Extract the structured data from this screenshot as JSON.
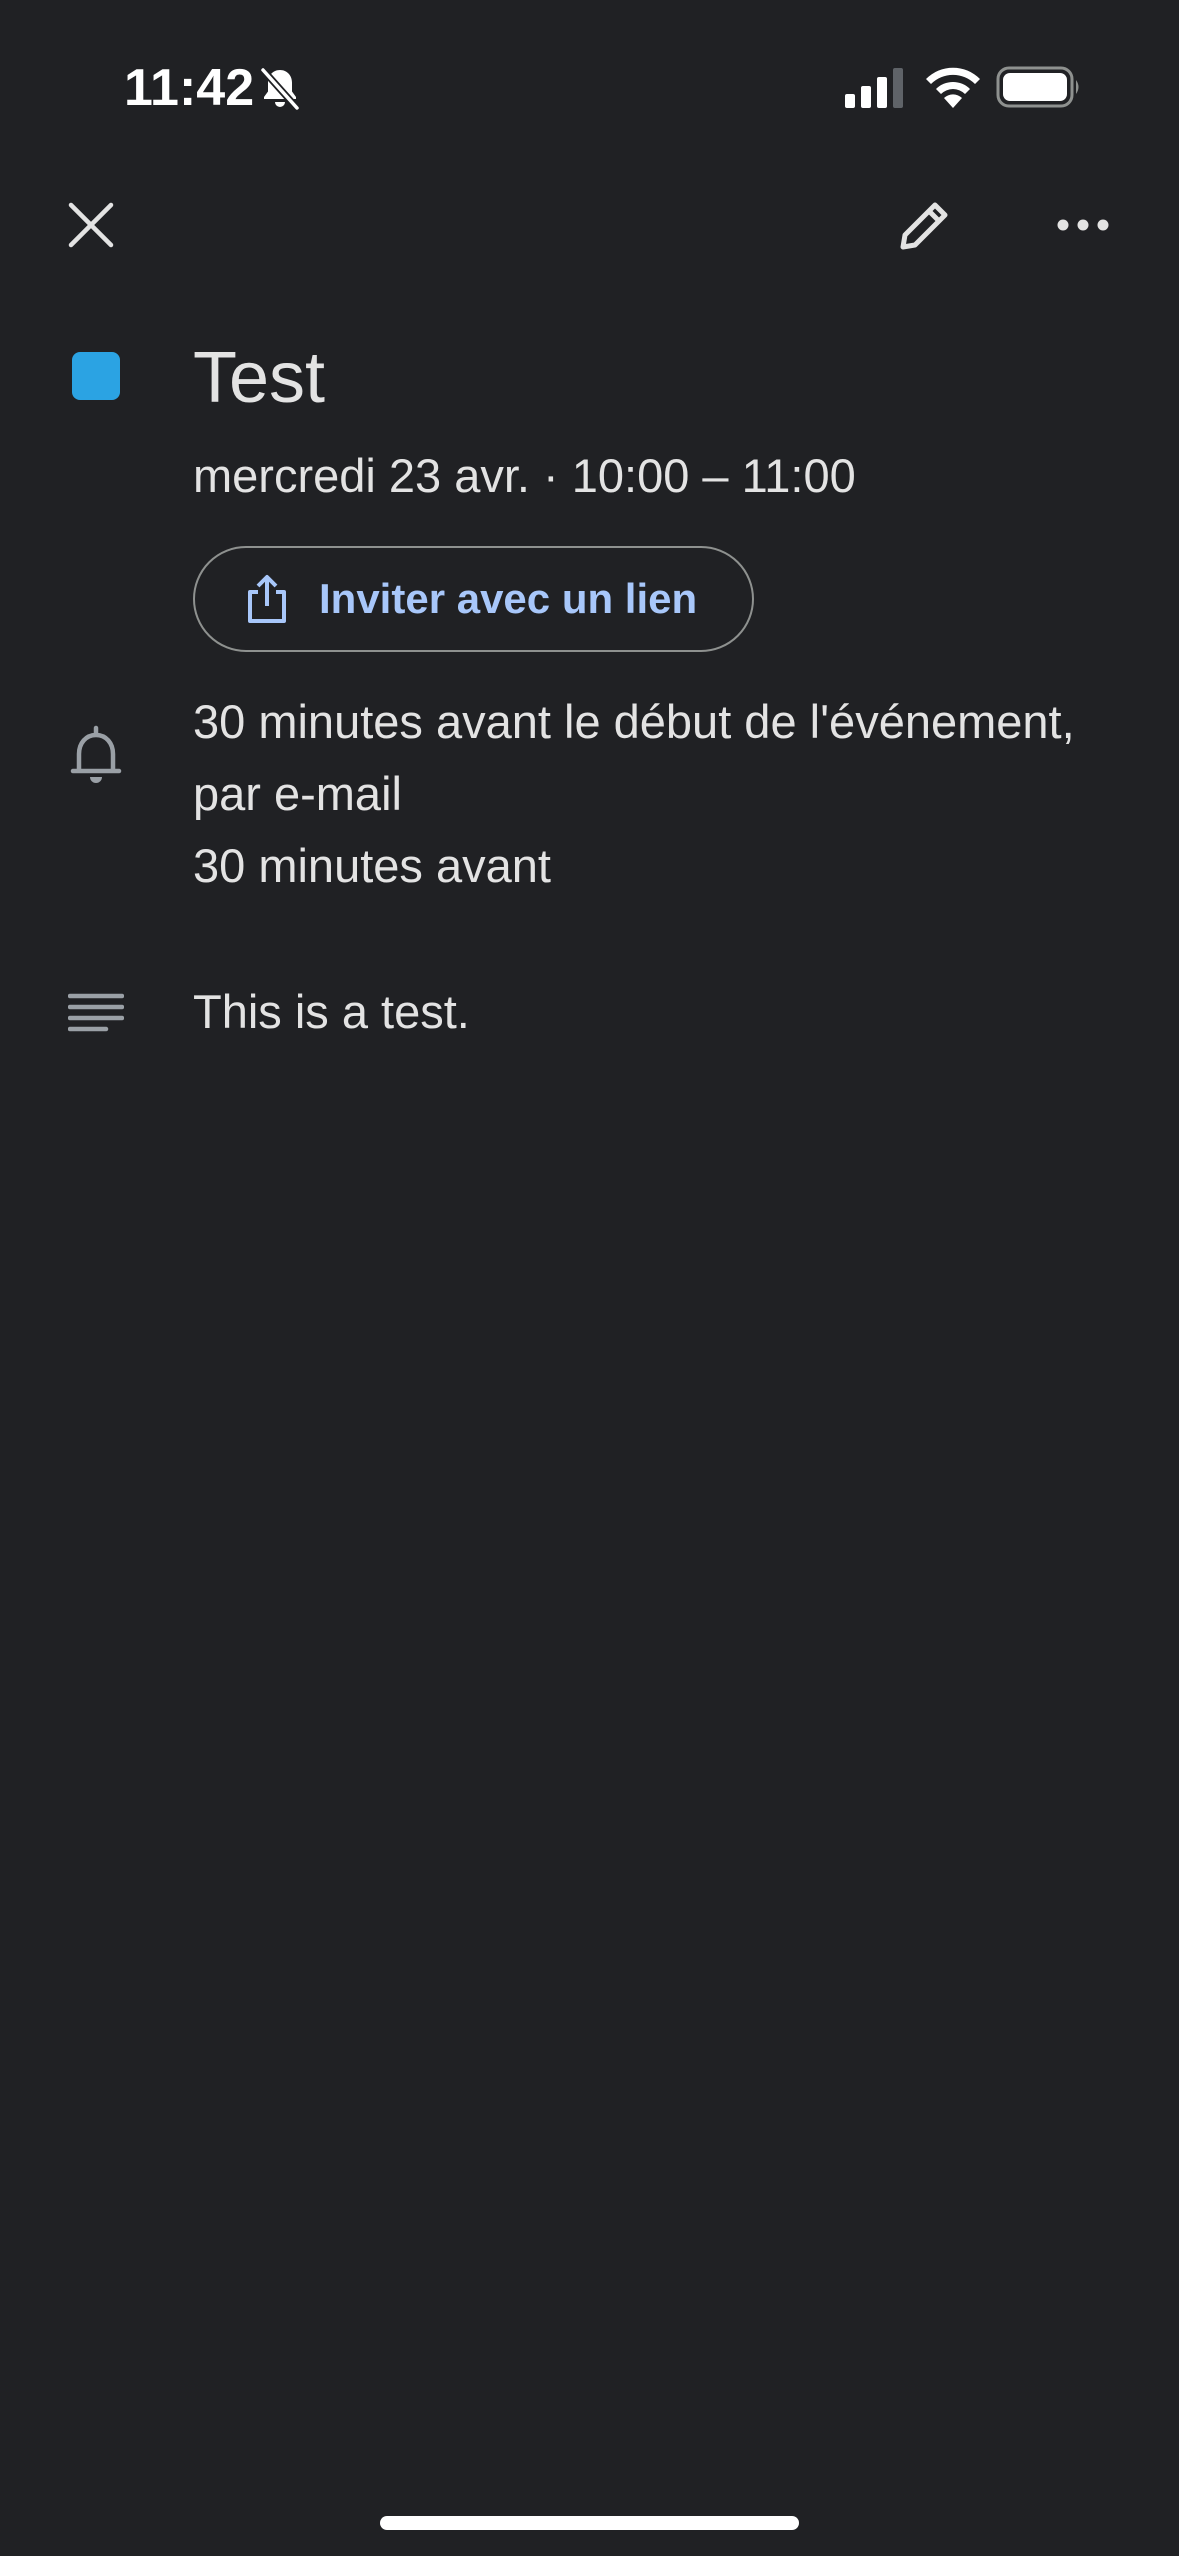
{
  "status_bar": {
    "time": "11:42",
    "icons": [
      "bell-slash-icon",
      "cellular-signal-icon",
      "wifi-icon",
      "battery-icon"
    ]
  },
  "app_bar": {
    "icons": [
      "close-icon",
      "pencil-icon",
      "more-horizontal-icon"
    ]
  },
  "event": {
    "color": "#2ba3e3",
    "title": "Test",
    "date_time": "mercredi 23 avr. · 10:00 – 11:00",
    "invite_label": "Inviter avec un lien",
    "reminders": [
      "30 minutes avant le début de l'événement,",
      "par e-mail",
      "30 minutes avant"
    ],
    "description": "This is a test."
  },
  "colors": {
    "background": "#202124",
    "text": "#e3e3e3",
    "link": "#a8c7fa",
    "icon": "#9aa0a6"
  }
}
